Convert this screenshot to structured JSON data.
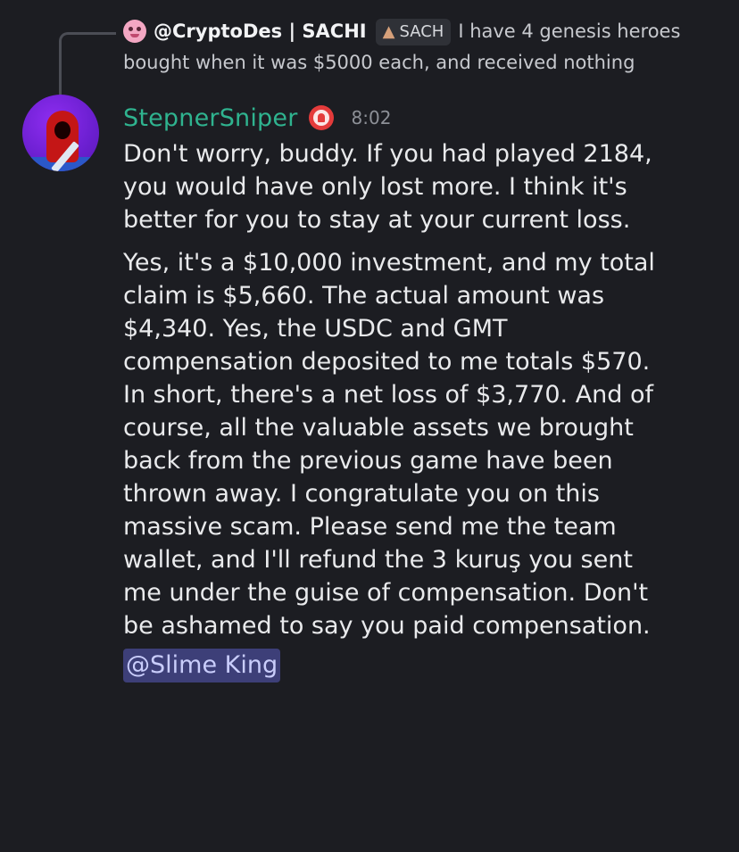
{
  "reply": {
    "author": "@CryptoDes | SACHI",
    "tag_label": "SACH",
    "text_line1": "I have 4 genesis heroes",
    "text_line2": "bought when it was $5000 each, and received nothing"
  },
  "message": {
    "author": "StepnerSniper",
    "timestamp": "8:02",
    "paragraph1": [
      "Don't worry, buddy. If you had played 2184,",
      "you would have only lost more. I think it's",
      "better for you to stay at your current loss."
    ],
    "paragraph2": [
      "Yes, it's a $10,000 investment, and my total",
      "claim is $5,660. The actual amount was",
      "$4,340. Yes, the USDC and GMT",
      "compensation deposited to me totals $570.",
      "In short, there's a net loss of $3,770. And of",
      "course, all the valuable assets we brought",
      "back from the previous game have been",
      "thrown away. I congratulate you on this",
      "massive scam. Please send me the team",
      "wallet, and I'll refund the 3 kuruş you sent",
      "me under the guise of compensation. Don't",
      "be ashamed to say you paid compensation."
    ],
    "mention": "@Slime King"
  },
  "colors": {
    "background": "#1c1d22",
    "username": "#2fb38f",
    "mention_bg": "#3d3f78",
    "mention_text": "#c9cdfb"
  },
  "icons": {
    "reply_avatar": "pink-character-avatar",
    "tag_icon": "mushroom-icon",
    "role_icon": "red-badge-icon",
    "avatar": "red-hooded-swordsman-avatar"
  }
}
